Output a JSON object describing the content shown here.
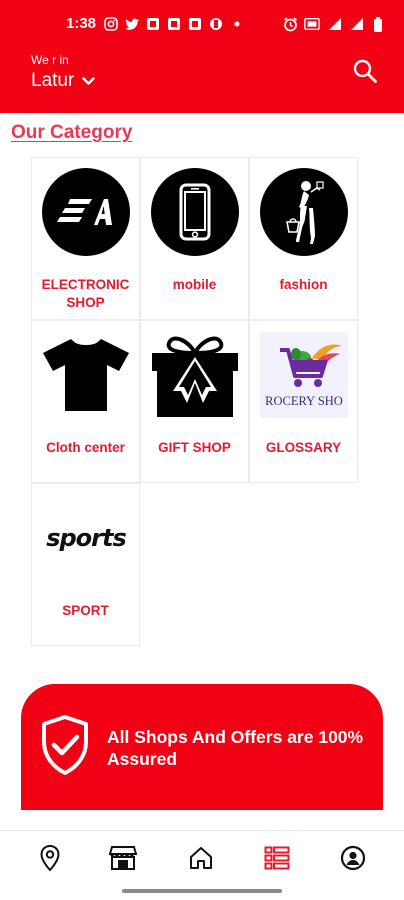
{
  "status_bar": {
    "time": "1:38"
  },
  "header": {
    "location_label": "We r in",
    "location_value": "Latur",
    "icons": [
      "chevron-down-icon",
      "search-icon"
    ]
  },
  "category": {
    "title": "Our Category",
    "items": [
      {
        "label": "ELECTRONIC SHOP",
        "icon": "ea-logo"
      },
      {
        "label": "mobile",
        "icon": "smartphone-icon"
      },
      {
        "label": "fashion",
        "icon": "fashion-woman-icon"
      },
      {
        "label": "Cloth center",
        "icon": "tshirt-icon"
      },
      {
        "label": "GIFT SHOP",
        "icon": "gift-box-icon"
      },
      {
        "label": "GLOSSARY",
        "icon": "grocery-cart-logo",
        "image_text": "ROCERY SHO"
      },
      {
        "label": "SPORT",
        "icon": "sports-wordmark",
        "image_text": "sports"
      }
    ]
  },
  "banner": {
    "text": "All Shops And Offers are 100% Assured",
    "icon": "shield-check-icon"
  },
  "bottom_nav": {
    "items": [
      {
        "name": "location",
        "icon": "location-pin-icon"
      },
      {
        "name": "shops",
        "icon": "storefront-icon"
      },
      {
        "name": "home",
        "icon": "home-icon"
      },
      {
        "name": "categories",
        "icon": "list-icon",
        "active": true
      },
      {
        "name": "profile",
        "icon": "profile-icon"
      }
    ]
  },
  "colors": {
    "brand_red": "#f20014",
    "label_red": "#e31b2f",
    "title_red": "#e53b53"
  }
}
